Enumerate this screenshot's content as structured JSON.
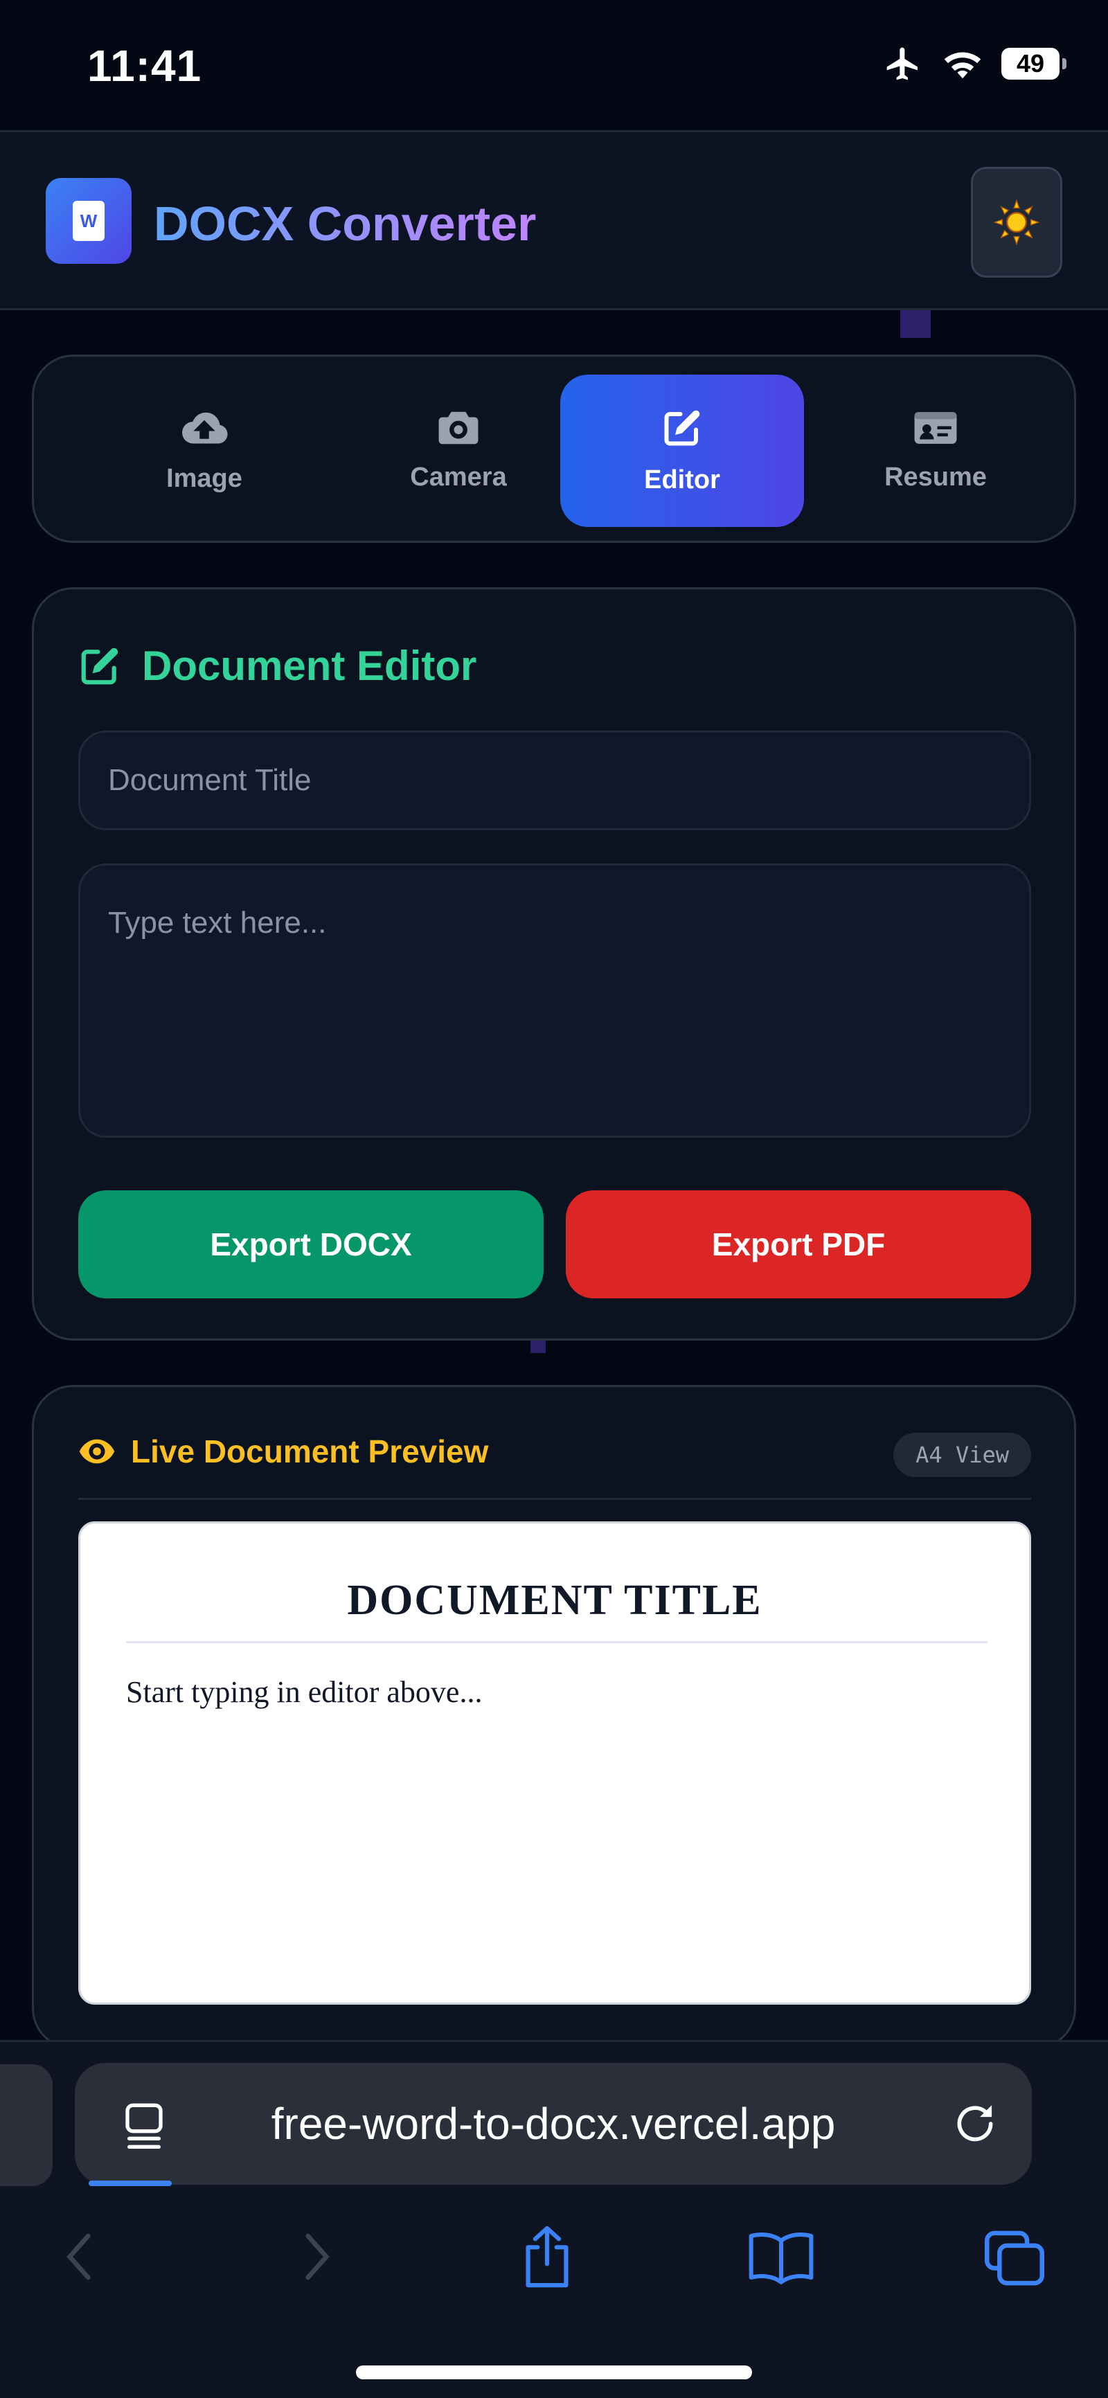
{
  "status_bar": {
    "time": "11:41",
    "battery": "49"
  },
  "header": {
    "app_title": "DOCX Converter",
    "logo_letter": "W"
  },
  "tabs": [
    {
      "label": "Image",
      "icon": "cloud-upload-icon",
      "active": false
    },
    {
      "label": "Camera",
      "icon": "camera-icon",
      "active": false
    },
    {
      "label": "Editor",
      "icon": "edit-icon",
      "active": true
    },
    {
      "label": "Resume",
      "icon": "id-card-icon",
      "active": false
    }
  ],
  "editor": {
    "title": "Document Editor",
    "title_placeholder": "Document Title",
    "body_placeholder": "Type text here...",
    "export_docx": "Export DOCX",
    "export_pdf": "Export PDF"
  },
  "preview": {
    "heading": "Live Document Preview",
    "badge": "A4 View",
    "doc_title": "DOCUMENT TITLE",
    "doc_body": "Start typing in editor above..."
  },
  "browser": {
    "url": "free-word-to-docx.vercel.app"
  },
  "colors": {
    "background": "#040814",
    "accent_blue": "#2563eb",
    "editor_green": "#34d399",
    "export_docx": "#059669",
    "export_pdf": "#dc2626",
    "preview_yellow": "#fbbf24"
  }
}
